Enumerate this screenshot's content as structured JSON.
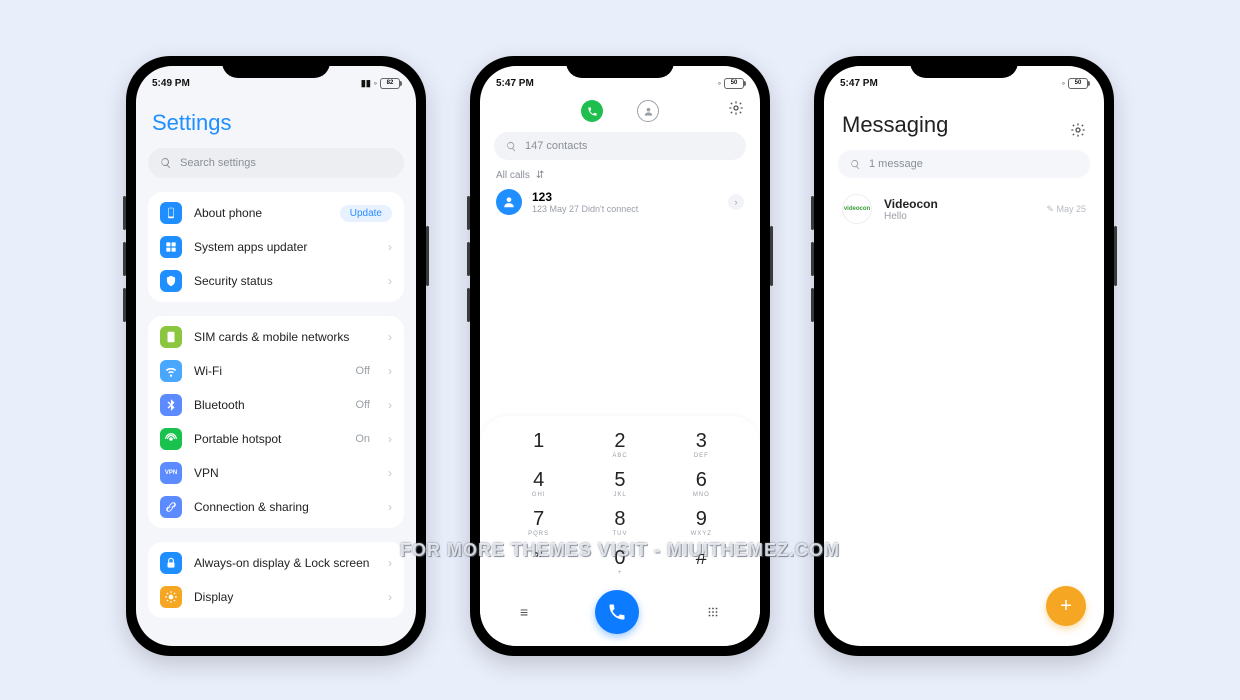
{
  "watermark": "FOR MORE THEMES VISIT - MIUITHEMEZ.COM",
  "phone1": {
    "status_time": "5:49 PM",
    "status_batt": "82",
    "title": "Settings",
    "search_placeholder": "Search settings",
    "group1": [
      {
        "label": "About phone",
        "icon_bg": "#1f8eff",
        "badge": "Update"
      },
      {
        "label": "System apps updater",
        "icon_bg": "#1f8eff"
      },
      {
        "label": "Security status",
        "icon_bg": "#1f8eff"
      }
    ],
    "group2": [
      {
        "label": "SIM cards & mobile networks",
        "icon_bg": "#8bc63f"
      },
      {
        "label": "Wi-Fi",
        "icon_bg": "#4aa7ff",
        "value": "Off"
      },
      {
        "label": "Bluetooth",
        "icon_bg": "#5b8bff",
        "value": "Off"
      },
      {
        "label": "Portable hotspot",
        "icon_bg": "#19c24d",
        "value": "On"
      },
      {
        "label": "VPN",
        "icon_bg": "#5b8bff",
        "icon_text": "VPN"
      },
      {
        "label": "Connection & sharing",
        "icon_bg": "#5b8bff"
      }
    ],
    "group3": [
      {
        "label": "Always-on display & Lock screen",
        "icon_bg": "#1f8eff"
      },
      {
        "label": "Display",
        "icon_bg": "#f5a623"
      }
    ]
  },
  "phone2": {
    "status_time": "5:47 PM",
    "status_batt": "50",
    "search_placeholder": "147 contacts",
    "filter_label": "All calls",
    "call": {
      "name": "123",
      "meta": "123  May 27 Didn't connect"
    },
    "keys": [
      [
        "1",
        ""
      ],
      [
        "2",
        "ABC"
      ],
      [
        "3",
        "DEF"
      ],
      [
        "4",
        "GHI"
      ],
      [
        "5",
        "JKL"
      ],
      [
        "6",
        "MNO"
      ],
      [
        "7",
        "PQRS"
      ],
      [
        "8",
        "TUV"
      ],
      [
        "9",
        "WXYZ"
      ],
      [
        "*",
        ""
      ],
      [
        "0",
        "+"
      ],
      [
        "#",
        ""
      ]
    ]
  },
  "phone3": {
    "status_time": "5:47 PM",
    "status_batt": "50",
    "title": "Messaging",
    "search_placeholder": "1 message",
    "thread": {
      "name": "Videocon",
      "preview": "Hello",
      "date": "May 25",
      "avatar_text": "videocon"
    }
  }
}
